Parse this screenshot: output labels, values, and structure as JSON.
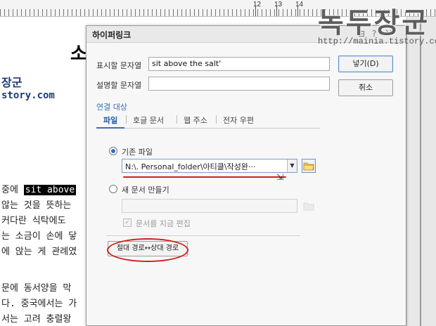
{
  "ruler": {
    "numbers": [
      "12",
      "13",
      "14"
    ]
  },
  "document": {
    "title": "소",
    "brand": "장군",
    "url": "story.com",
    "lines": [
      {
        "before": "중에 ",
        "selected": "sit above",
        "after": ""
      },
      {
        "before": "않는 것을 뜻하는",
        "selected": "",
        "after": ""
      },
      {
        "before": "커다란 식탁에도 ",
        "selected": "",
        "after": ""
      },
      {
        "before": "는 소금이 손에 닿",
        "selected": "",
        "after": ""
      },
      {
        "before": "에 앉는 게 관례였",
        "selected": "",
        "after": ""
      },
      {
        "before": "문에 동서양을 막",
        "selected": "",
        "after": ""
      },
      {
        "before": "다. 중국에서는 가",
        "selected": "",
        "after": ""
      },
      {
        "before": "서는 고려 충렬왕",
        "selected": "",
        "after": ""
      }
    ]
  },
  "watermark": {
    "title": "녹두장군",
    "url": "http://mainia.tistory.com"
  },
  "dialog": {
    "title": "하이퍼링크",
    "titlebar_buttons": {
      "help": "?",
      "close": "×"
    },
    "display_text_label": "표시할 문자열",
    "display_text_value": "sit above the salt'",
    "description_label": "설명할 문자열",
    "description_value": "",
    "insert_button": "넣기(D)",
    "cancel_button": "취소",
    "target_group": "연결 대상",
    "tabs": [
      "파일",
      "호글 문서",
      "웹 주소",
      "전자 우편"
    ],
    "existing_file_label": "기존 파일",
    "existing_file_path": "N:\\. Personal_folder\\아티클\\작성완···",
    "new_doc_label": "새 문서 만들기",
    "edit_now_label": "문서를 지금 편집",
    "path_toggle_button": "절대 경로↔상대 경로"
  },
  "colors": {
    "accent": "#3b6fb6",
    "annotation": "#d0211d"
  }
}
